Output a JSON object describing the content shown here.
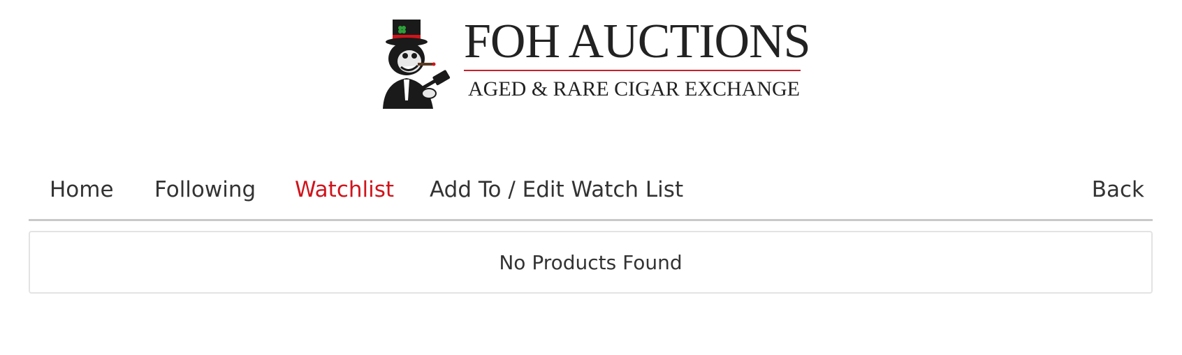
{
  "brand": {
    "title": "FOH AUCTIONS",
    "subtitle": "AGED & RARE CIGAR EXCHANGE",
    "mascot": "top-hat-monkey-with-gavel-icon",
    "accent_color": "#c8202a"
  },
  "nav": {
    "items": [
      {
        "label": "Home",
        "active": false
      },
      {
        "label": "Following",
        "active": false
      },
      {
        "label": "Watchlist",
        "active": true
      },
      {
        "label": "Add To / Edit Watch List",
        "active": false
      }
    ],
    "back_label": "Back",
    "active_color": "#d0141c"
  },
  "content": {
    "empty_message": "No Products Found"
  }
}
